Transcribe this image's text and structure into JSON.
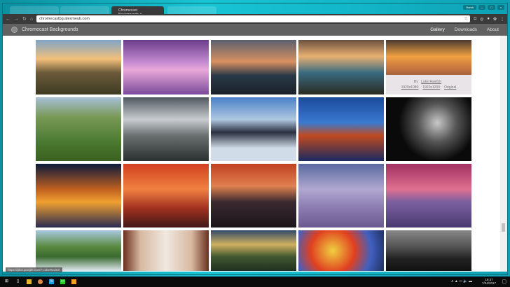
{
  "browser": {
    "tabs": [
      "",
      "",
      "Chromecast Backgrounds",
      ""
    ],
    "active_tab": "Chromecast Backgrounds",
    "url": "chromecastbg.alexmeub.com",
    "user": "Harsh",
    "status_url": "https://plus.google.com/+LukeRavitch"
  },
  "app": {
    "title": "Chromecast Backgrounds",
    "nav": [
      "Gallery",
      "Downloads",
      "About"
    ]
  },
  "credit": {
    "by": "By",
    "author": "Luke Ravitch",
    "links": [
      "1920x1080",
      "1920x1200",
      "Original"
    ]
  },
  "images": [
    [
      "linear-gradient(180deg,#7fa4c8,#f2c07a 35%,#6b5a3a 60%,#3d3a22)",
      "linear-gradient(180deg,#6a3d8a,#c38ad0 40%,#e8a8d8 55%,#7b4a9a)",
      "linear-gradient(180deg,#5a6070,#d89060 40%,#2a3a48 65%,#1a2028)",
      "linear-gradient(180deg,#6a5040,#e8b070 30%,#3a6a80 60%,#2a2a20)",
      "linear-gradient(180deg,#4a3a30,#f0a040 30%,#c07040 55%,#3a3030)"
    ],
    [
      "linear-gradient(180deg,#a8c0d8,#7a9a58 30%,#4a7a30 70%,#3a6020)",
      "linear-gradient(180deg,#505860,#c8ccd0 35%,#6a7070 60%,#2a3030)",
      "linear-gradient(180deg,#4a80c8,#b0c8e0 35%,#2a3040 55%,#d0dce8 80%)",
      "linear-gradient(180deg,#1a4a9a,#3a7ad0 40%,#c04a20 60%,#1a2a60)",
      "radial-gradient(circle at 60% 40%,#c8c8c8,#555 30%,#0a0a0a 60%)"
    ],
    [
      "linear-gradient(180deg,#0a1a3a,#c06020 40%,#f0a030 60%,#2a2a50)",
      "linear-gradient(180deg,#d04020,#f08040 40%,#a03020 70%,#401818)",
      "linear-gradient(180deg,#c04020,#e08050 35%,#3a2a30 60%,#1a1418)",
      "linear-gradient(180deg,#5a6aa0,#b0a8d0 40%,#8a7ab0 70%,#6a5a90)",
      "linear-gradient(180deg,#a03060,#e07090 40%,#7a60a0 60%,#4a3a70)"
    ],
    [
      "linear-gradient(180deg,#a8c8e0,#5a8a40 40%,#3a6a30 65%,#e0e8f0)",
      "linear-gradient(90deg,#6a3020,#d8b8a0 20%,#f0e8e0 50%,#d8b8a0 80%,#6a3020)",
      "linear-gradient(180deg,#304868,#d0b060 35%,#405830 65%,#203020)",
      "radial-gradient(circle at 40% 50%,#f0d040,#e04020 40%,#4060c0 70%,#203060)",
      "linear-gradient(180deg,#888,#555 40%,#222 70%,#111)"
    ]
  ],
  "taskbar": {
    "time": "19:37",
    "date": "7/24/2017"
  }
}
